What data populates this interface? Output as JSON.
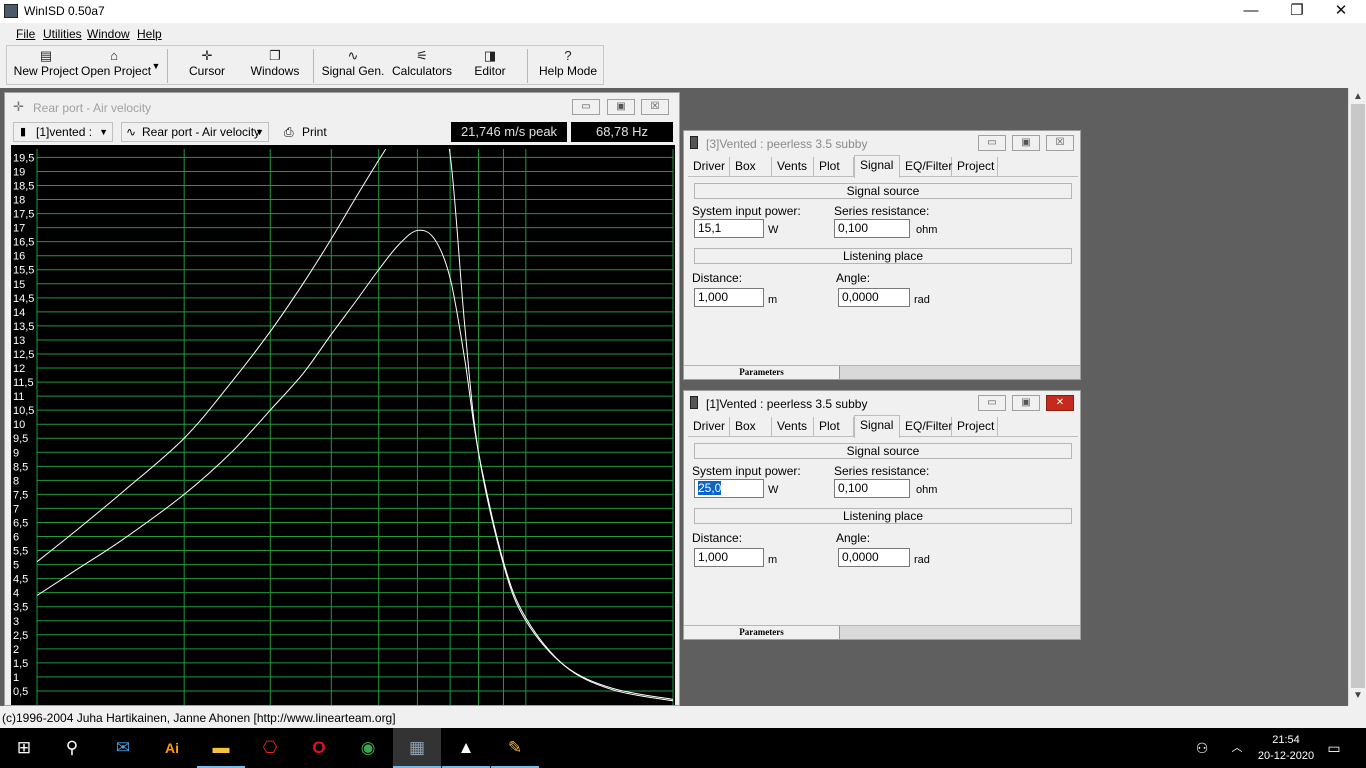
{
  "app": {
    "title": "WinISD 0.50a7",
    "window_controls": {
      "minimize": "—",
      "restore": "❐",
      "close": "✕"
    }
  },
  "menu": [
    "File",
    "Utilities",
    "Window",
    "Help"
  ],
  "toolbar": [
    {
      "label": "New Project",
      "icon": "document-icon",
      "glyph": "▤"
    },
    {
      "label": "Open Project",
      "icon": "folder-open-icon",
      "glyph": "⌂"
    },
    {
      "label": "Cursor",
      "icon": "cursor-icon",
      "glyph": "✛"
    },
    {
      "label": "Windows",
      "icon": "windows-icon",
      "glyph": "❐"
    },
    {
      "label": "Signal Gen.",
      "icon": "sine-wave-icon",
      "glyph": "∿"
    },
    {
      "label": "Calculators",
      "icon": "calculator-icon",
      "glyph": "⚟"
    },
    {
      "label": "Editor",
      "icon": "editor-icon",
      "glyph": "◨"
    },
    {
      "label": "Help Mode",
      "icon": "help-icon",
      "glyph": "?"
    }
  ],
  "graph_window": {
    "title": "Rear port - Air velocity",
    "project_combo": "[1]vented :",
    "plot_combo": "Rear port - Air velocity",
    "print_label": "Print",
    "readout_peak": "21,746 m/s peak",
    "readout_freq": "68,78 Hz"
  },
  "chart_data": {
    "type": "line",
    "title": "",
    "xlabel": "",
    "ylabel": "",
    "ylim": [
      0,
      19.8
    ],
    "x_scale": "log",
    "xlim": [
      10,
      200
    ],
    "y_ticks": [
      "0,5",
      "1",
      "1,5",
      "2",
      "2,5",
      "3",
      "3,5",
      "4",
      "4,5",
      "5",
      "5,5",
      "6",
      "6,5",
      "7",
      "7,5",
      "8",
      "8,5",
      "9",
      "9,5",
      "10",
      "10,5",
      "11",
      "11,5",
      "12",
      "12,5",
      "13",
      "13,5",
      "14",
      "14,5",
      "15",
      "15,5",
      "16",
      "16,5",
      "17",
      "17,5",
      "18",
      "18,5",
      "19",
      "19,5"
    ],
    "grid": true,
    "colors": {
      "background": "#000000",
      "grid": "#1f9a3c",
      "line": "#ffffff",
      "text": "#ffffff"
    },
    "series": [
      {
        "x": [
          10,
          12,
          15,
          20,
          25,
          30,
          35,
          40,
          45,
          50,
          55,
          60,
          65,
          70,
          75,
          80,
          90,
          100,
          120,
          150,
          200
        ],
        "values": [
          5.1,
          6.2,
          7.6,
          9.5,
          11.5,
          13.3,
          15.0,
          16.6,
          18.1,
          19.4,
          20.5,
          21.3,
          21.6,
          19.6,
          13.5,
          9.0,
          5.0,
          3.0,
          1.4,
          0.6,
          0.2
        ]
      },
      {
        "x": [
          10,
          12,
          15,
          20,
          25,
          30,
          35,
          40,
          45,
          50,
          55,
          60,
          65,
          70,
          75,
          80,
          90,
          100,
          120,
          150,
          200
        ],
        "values": [
          3.9,
          4.8,
          5.9,
          7.5,
          9.0,
          10.5,
          11.8,
          13.2,
          14.4,
          15.5,
          16.4,
          16.9,
          16.6,
          15.2,
          12.3,
          9.0,
          5.1,
          3.1,
          1.4,
          0.55,
          0.15
        ]
      }
    ]
  },
  "param_windows": [
    {
      "id": "win3",
      "title": "[3]Vented : peerless 3.5 subby",
      "tabs": [
        "Driver",
        "Box",
        "Vents",
        "Plot",
        "Signal",
        "EQ/Filter",
        "Project"
      ],
      "active_tab": "Signal",
      "signal_source": "Signal source",
      "system_input_power_label": "System input power:",
      "system_input_power": "15,1",
      "power_unit": "W",
      "series_resistance_label": "Series resistance:",
      "series_resistance": "0,100",
      "ohm_unit": "ohm",
      "listening_place": "Listening place",
      "distance_label": "Distance:",
      "distance": "1,000",
      "distance_unit": "m",
      "angle_label": "Angle:",
      "angle": "0,0000",
      "angle_unit": "rad",
      "bottom_tab": "Parameters"
    },
    {
      "id": "win1",
      "title": "[1]Vented : peerless 3.5 subby",
      "tabs": [
        "Driver",
        "Box",
        "Vents",
        "Plot",
        "Signal",
        "EQ/Filter",
        "Project"
      ],
      "active_tab": "Signal",
      "signal_source": "Signal source",
      "system_input_power_label": "System input power:",
      "system_input_power": "25,0",
      "power_unit": "W",
      "series_resistance_label": "Series resistance:",
      "series_resistance": "0,100",
      "ohm_unit": "ohm",
      "listening_place": "Listening place",
      "distance_label": "Distance:",
      "distance": "1,000",
      "distance_unit": "m",
      "angle_label": "Angle:",
      "angle": "0,0000",
      "angle_unit": "rad",
      "bottom_tab": "Parameters"
    }
  ],
  "statusbar": {
    "text": "(c)1996-2004 Juha Hartikainen, Janne Ahonen [http://www.linearteam.org]"
  },
  "taskbar": {
    "apps": [
      {
        "name": "start-button",
        "glyph": "⊞"
      },
      {
        "name": "search-icon",
        "glyph": "⚲"
      },
      {
        "name": "mail-app-icon",
        "glyph": "✉"
      },
      {
        "name": "illustrator-app-icon",
        "glyph": "Ai"
      },
      {
        "name": "file-explorer-icon",
        "glyph": "▬"
      },
      {
        "name": "acrobat-app-icon",
        "glyph": "⎔"
      },
      {
        "name": "opera-app-icon",
        "glyph": "O"
      },
      {
        "name": "chrome-app-icon",
        "glyph": "◉"
      },
      {
        "name": "winisd-app-icon",
        "glyph": "▦"
      },
      {
        "name": "photos-app-icon",
        "glyph": "▲"
      },
      {
        "name": "paint-app-icon",
        "glyph": "✎"
      }
    ],
    "time": "21:54",
    "date": "20-12-2020"
  }
}
